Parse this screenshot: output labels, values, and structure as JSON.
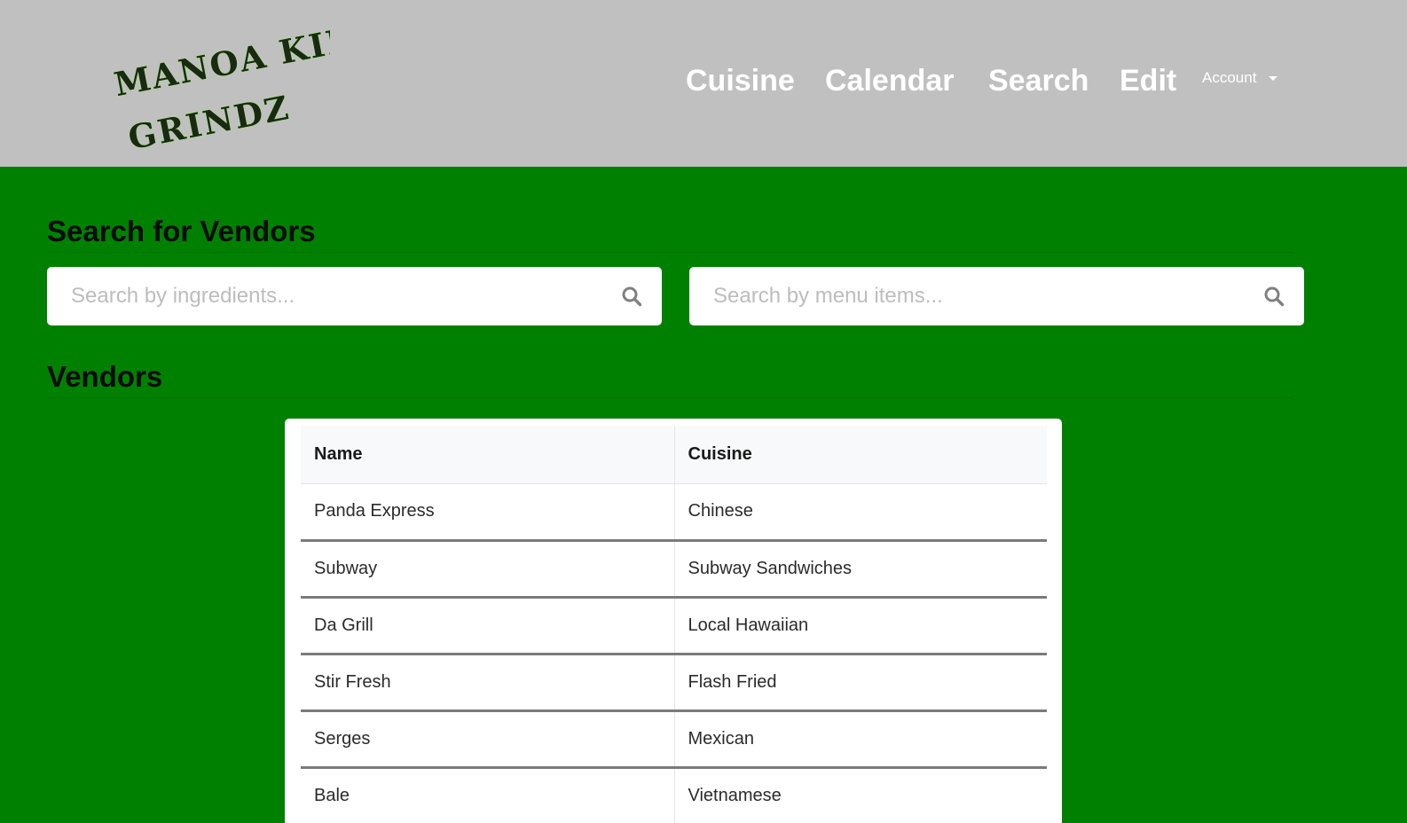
{
  "header": {
    "logo_text": [
      "MANOA KINE",
      "GRINDZ"
    ],
    "nav": {
      "cuisine": "Cuisine",
      "calendar": "Calendar",
      "search": "Search",
      "edit": "Edit",
      "account": "Account"
    }
  },
  "search_section": {
    "title": "Search for Vendors",
    "ingredients_placeholder": "Search by ingredients...",
    "menu_items_placeholder": "Search by menu items..."
  },
  "vendors_section": {
    "title": "Vendors",
    "columns": [
      "Name",
      "Cuisine"
    ],
    "rows": [
      {
        "name": "Panda Express",
        "cuisine": "Chinese"
      },
      {
        "name": "Subway",
        "cuisine": "Subway Sandwiches"
      },
      {
        "name": "Da Grill",
        "cuisine": "Local Hawaiian"
      },
      {
        "name": "Stir Fresh",
        "cuisine": "Flash Fried"
      },
      {
        "name": "Serges",
        "cuisine": "Mexican"
      },
      {
        "name": "Bale",
        "cuisine": "Vietnamese"
      }
    ]
  },
  "colors": {
    "header_bg": "#c0c0c0",
    "page_bg": "#008000",
    "logo_text": "#1a2a12",
    "logo_outline": "#a6e28a"
  },
  "icons": {
    "search": "search-icon",
    "account_dropdown": "caret-down-icon"
  }
}
